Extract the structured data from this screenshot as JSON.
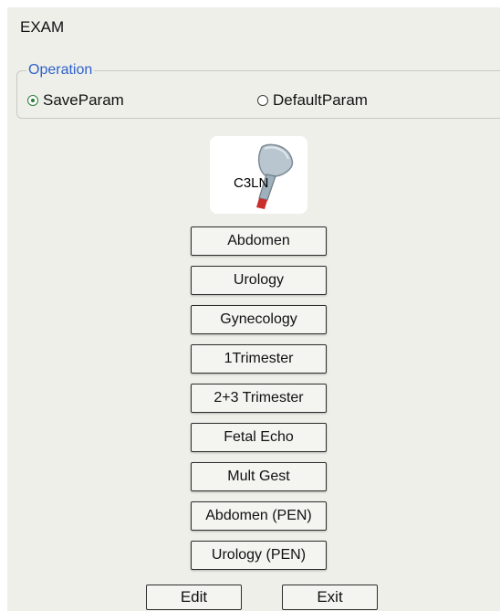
{
  "header": {
    "title": "EXAM"
  },
  "operation": {
    "legend": "Operation",
    "options": [
      {
        "label": "SaveParam",
        "selected": true
      },
      {
        "label": "DefaultParam",
        "selected": false
      }
    ]
  },
  "probe": {
    "name": "C3LN",
    "icon": "ultrasound-probe-icon"
  },
  "presets": [
    "Abdomen",
    "Urology",
    "Gynecology",
    "1Trimester",
    "2+3 Trimester",
    "Fetal Echo",
    "Mult Gest",
    "Abdomen (PEN)",
    "Urology (PEN)"
  ],
  "actions": {
    "edit": "Edit",
    "exit": "Exit"
  },
  "colors": {
    "accent": "#2f62c9",
    "panel": "#efefea",
    "selected_radio": "#2a7d3a"
  }
}
